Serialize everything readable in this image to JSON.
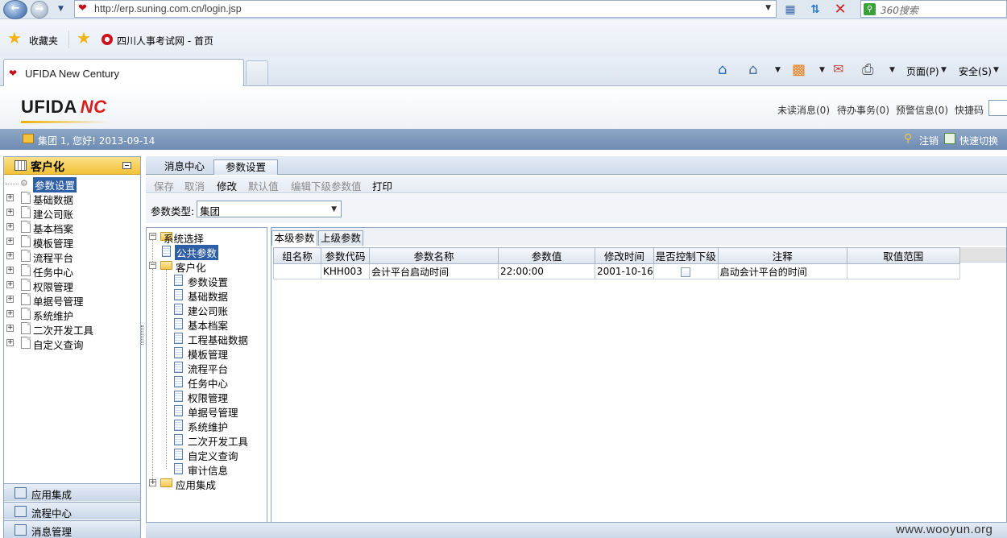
{
  "browser": {
    "url": "http://erp.suning.com.cn/login.jsp",
    "search_placeholder": "360搜索",
    "favorites_label": "收藏夹",
    "favorite_site": "四川人事考试网 - 首页",
    "tab_title": "UFIDA New Century",
    "page_menu": "页面(P)",
    "security_menu": "安全(S)"
  },
  "app": {
    "logo_text": "UFIDA",
    "logo_mark": "NC",
    "header_links": {
      "unread": "未读消息(0)",
      "todo": "待办事务(0)",
      "alerts": "预警信息(0)",
      "quick_code": "快捷码"
    },
    "user_text": "集团 1, 您好! 2013-09-14",
    "logout": "注销",
    "quick_switch": "快速切换"
  },
  "left_panel": {
    "title": "客户化",
    "items": [
      {
        "label": "参数设置",
        "selected": true
      },
      {
        "label": "基础数据"
      },
      {
        "label": "建公司账"
      },
      {
        "label": "基本档案"
      },
      {
        "label": "模板管理"
      },
      {
        "label": "流程平台"
      },
      {
        "label": "任务中心"
      },
      {
        "label": "权限管理"
      },
      {
        "label": "单据号管理"
      },
      {
        "label": "系统维护"
      },
      {
        "label": "二次开发工具"
      },
      {
        "label": "自定义查询"
      }
    ],
    "bottom": [
      "应用集成",
      "流程中心",
      "消息管理"
    ]
  },
  "content": {
    "tabs": [
      "消息中心",
      "参数设置"
    ],
    "toolbar": [
      {
        "label": "保存",
        "enabled": false
      },
      {
        "label": "取消",
        "enabled": false
      },
      {
        "label": "修改",
        "enabled": true
      },
      {
        "label": "默认值",
        "enabled": false
      },
      {
        "label": "编辑下级参数值",
        "enabled": false
      },
      {
        "label": "打印",
        "enabled": true
      }
    ],
    "param_type_label": "参数类型:",
    "param_type_value": "集团",
    "tree": {
      "root": "系统选择",
      "public": "公共参数",
      "custom": "客户化",
      "children": [
        "参数设置",
        "基础数据",
        "建公司账",
        "基本档案",
        "工程基础数据",
        "模板管理",
        "流程平台",
        "任务中心",
        "权限管理",
        "单据号管理",
        "系统维护",
        "二次开发工具",
        "自定义查询",
        "审计信息"
      ],
      "app_integration": "应用集成"
    },
    "grid_tabs": [
      "本级参数",
      "上级参数"
    ],
    "columns": [
      "组名称",
      "参数代码",
      "参数名称",
      "参数值",
      "修改时间",
      "是否控制下级",
      "注释",
      "取值范围"
    ],
    "rows": [
      {
        "group": "",
        "code": "KHH003",
        "name": "会计平台启动时间",
        "value": "22:00:00",
        "modified": "2001-10-16",
        "control": false,
        "note": "启动会计平台的时间",
        "range": ""
      }
    ]
  },
  "watermark": "www.wooyun.org"
}
